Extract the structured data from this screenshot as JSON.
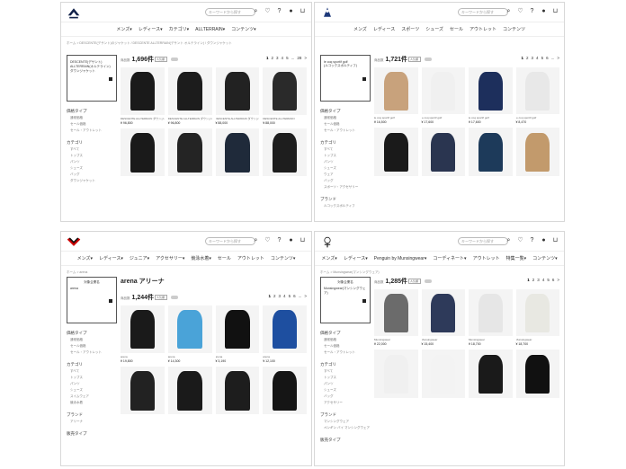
{
  "panels": [
    {
      "brand": "descente",
      "search_placeholder": "キーワードから探す",
      "nav": [
        "メンズ▾",
        "レディース▾",
        "カテゴリ▾",
        "ALLTERRAIN▾",
        "コンテンツ▾"
      ],
      "breadcrumb": "ホーム > DESCENTE(デサント)のジャケット / DESCENTE ALLTERRAIN(デサント オルテライン) / ダウンジャケット",
      "brandbox_title": "",
      "brandbox_lines": [
        "DESCENTE(デサント)",
        "ALLTERRAIN(オルテライン)",
        "ダウンジャケット"
      ],
      "side_sections": [
        {
          "title": "価格タイプ",
          "items": [
            "通常価格",
            "セール価格",
            "セール・アウトレット"
          ]
        },
        {
          "title": "カテゴリ",
          "items": [
            "すべて",
            "トップス",
            "パンツ",
            "シューズ",
            "バッグ",
            "ダウンジャケット"
          ]
        }
      ],
      "count_prefix": "商品数",
      "count": "1,696件",
      "sort": "人気順",
      "pages": [
        "1",
        "2",
        "3",
        "4",
        "5",
        "...",
        "28",
        ">"
      ],
      "items": [
        {
          "meta": "DESCENTE ALLTERRAIN ダウンジャケット",
          "price": "¥ 96,800",
          "color": "#1a1a1a"
        },
        {
          "meta": "DESCENTE ALLTERRAIN ダウンジャケット",
          "price": "¥ 96,800",
          "color": "#1c1c1c"
        },
        {
          "meta": "DESCENTE ALLTERRAIN ダウンジャケット",
          "price": "¥ 88,000",
          "color": "#222"
        },
        {
          "meta": "DESCENTE ALLTERRAIN",
          "price": "¥ 88,000",
          "color": "#2a2a2a"
        },
        {
          "meta": "",
          "price": "",
          "color": "#1a1a1a"
        },
        {
          "meta": "",
          "price": "",
          "color": "#242424"
        },
        {
          "meta": "",
          "price": "",
          "color": "#1f2a3a"
        },
        {
          "meta": "",
          "price": "",
          "color": "#1e1e1e"
        }
      ]
    },
    {
      "brand": "lecoqsportif",
      "search_placeholder": "キーワードから探す",
      "nav": [
        "メンズ",
        "レディース",
        "スポーツ",
        "シューズ",
        "セール",
        "アウトレット",
        "コンテンツ"
      ],
      "breadcrumb": "",
      "brandbox_title": "",
      "brandbox_lines": [
        "le coq sportif golf",
        "(ルコックスポルティフ)"
      ],
      "side_sections": [
        {
          "title": "価格タイプ",
          "items": [
            "通常価格",
            "セール価格",
            "セール・アウトレット"
          ]
        },
        {
          "title": "カテゴリ",
          "items": [
            "すべて",
            "トップス",
            "パンツ",
            "シューズ",
            "ウェア",
            "バッグ",
            "スポーツ・アクセサリー"
          ]
        },
        {
          "title": "ブランド",
          "items": [
            "ルコックスポルティフ"
          ]
        }
      ],
      "count_prefix": "商品数",
      "count": "1,721件",
      "sort": "人気順",
      "pages": [
        "1",
        "2",
        "3",
        "4",
        "5",
        "6",
        "...",
        ">"
      ],
      "items": [
        {
          "meta": "le coq sportif golf",
          "price": "¥ 16,500",
          "color": "#c8a27c"
        },
        {
          "meta": "le coq sportif golf",
          "price": "¥ 17,600",
          "color": "#f0f0f0"
        },
        {
          "meta": "le coq sportif golf",
          "price": "¥ 17,600",
          "color": "#1d2f5c"
        },
        {
          "meta": "le coq sportif golf",
          "price": "¥ 8,470",
          "color": "#e8e8e8"
        },
        {
          "meta": "",
          "price": "",
          "color": "#1a1a1a"
        },
        {
          "meta": "",
          "price": "",
          "color": "#2a3550"
        },
        {
          "meta": "",
          "price": "",
          "color": "#1d3a5a"
        },
        {
          "meta": "",
          "price": "",
          "color": "#c29a6c"
        }
      ]
    },
    {
      "brand": "arena",
      "search_placeholder": "キーワードから探す",
      "nav": [
        "メンズ▾",
        "レディース▾",
        "ジュニア▾",
        "アクセサリー▾",
        "競泳水着▾",
        "セール",
        "アウトレット",
        "コンテンツ▾"
      ],
      "breadcrumb": "ホーム > arena",
      "brandbox_title": "対象企業名",
      "brandbox_lines": [
        "arena"
      ],
      "page_title": "arena アリーナ",
      "side_sections": [
        {
          "title": "価格タイプ",
          "items": [
            "通常価格",
            "セール価格",
            "セール・アウトレット"
          ]
        },
        {
          "title": "カテゴリ",
          "items": [
            "すべて",
            "トップス",
            "パンツ",
            "シューズ",
            "スイムウェア",
            "競泳水着"
          ]
        },
        {
          "title": "ブランド",
          "items": [
            "アリーナ"
          ]
        },
        {
          "title": "販売タイプ",
          "items": []
        }
      ],
      "count_prefix": "商品数",
      "count": "1,244件",
      "sort": "人気順",
      "pages": [
        "1",
        "2",
        "3",
        "4",
        "5",
        "6",
        "...",
        ">"
      ],
      "items": [
        {
          "meta": "arena",
          "price": "¥ 19,800",
          "color": "#1a1a1a"
        },
        {
          "meta": "arena",
          "price": "¥ 14,300",
          "color": "#4aa3d8"
        },
        {
          "meta": "arena",
          "price": "¥ 3,190",
          "color": "#111"
        },
        {
          "meta": "arena",
          "price": "¥ 12,100",
          "color": "#1e4fa0"
        },
        {
          "meta": "",
          "price": "",
          "color": "#222"
        },
        {
          "meta": "",
          "price": "",
          "color": "#1a1a1a"
        },
        {
          "meta": "",
          "price": "",
          "color": "#1d1d1d"
        },
        {
          "meta": "",
          "price": "",
          "color": "#151515"
        }
      ]
    },
    {
      "brand": "munsingwear",
      "search_placeholder": "キーワードから探す",
      "nav": [
        "メンズ▾",
        "レディース▾",
        "Penguin by Munsingwear▾",
        "コーディネート▾",
        "アウトレット",
        "特集一覧▾",
        "コンテンツ▾"
      ],
      "breadcrumb": "ホーム > Munsingwear(マンシングウェア)",
      "brandbox_title": "対象企業名",
      "brandbox_lines": [
        "Munsingwear(マンシングウェア)"
      ],
      "side_sections": [
        {
          "title": "価格タイプ",
          "items": [
            "通常価格",
            "セール価格",
            "セール・アウトレット"
          ]
        },
        {
          "title": "カテゴリ",
          "items": [
            "すべて",
            "トップス",
            "パンツ",
            "シューズ",
            "バッグ",
            "アクセサリー"
          ]
        },
        {
          "title": "ブランド",
          "items": [
            "マンシングウェア",
            "ペンギン バイ マンシングウェア"
          ]
        },
        {
          "title": "販売タイプ",
          "items": []
        }
      ],
      "count_prefix": "商品数",
      "count": "1,285件",
      "sort": "人気順",
      "pages": [
        "1",
        "2",
        "3",
        "4",
        "5",
        "6",
        ">"
      ],
      "items": [
        {
          "meta": "Munsingwear",
          "price": "¥ 22,000",
          "color": "#6b6b6b"
        },
        {
          "meta": "Munsingwear",
          "price": "¥ 15,400",
          "color": "#2e3a5a"
        },
        {
          "meta": "Munsingwear",
          "price": "¥ 18,700",
          "color": "#e6e6e6"
        },
        {
          "meta": "Munsingwear",
          "price": "¥ 18,700",
          "color": "#e8e8e2"
        },
        {
          "meta": "",
          "price": "",
          "color": "#f0f0f0"
        },
        {
          "meta": "",
          "price": "",
          "color": "#f3f3f3"
        },
        {
          "meta": "",
          "price": "",
          "color": "#1a1a1a"
        },
        {
          "meta": "",
          "price": "",
          "color": "#111"
        }
      ]
    }
  ]
}
